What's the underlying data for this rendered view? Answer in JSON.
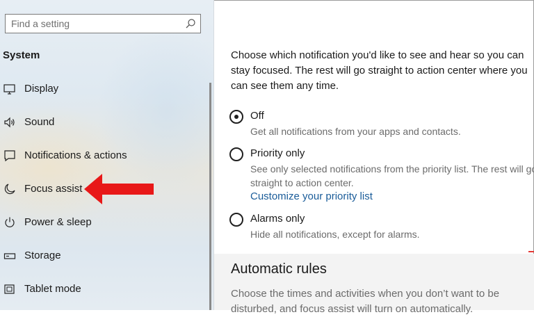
{
  "search": {
    "placeholder": "Find a setting",
    "icon": "search-icon"
  },
  "sidebar": {
    "section_title": "System",
    "items": [
      {
        "label": "Display",
        "icon": "display-icon"
      },
      {
        "label": "Sound",
        "icon": "speaker-icon"
      },
      {
        "label": "Notifications & actions",
        "icon": "notifications-icon"
      },
      {
        "label": "Focus assist",
        "icon": "moon-icon"
      },
      {
        "label": "Power & sleep",
        "icon": "power-icon"
      },
      {
        "label": "Storage",
        "icon": "storage-icon"
      },
      {
        "label": "Tablet mode",
        "icon": "tablet-icon"
      }
    ]
  },
  "annotation": {
    "arrow_color": "#e81818",
    "target": "Focus assist"
  },
  "main": {
    "intro": "Choose which notification you'd like to see and hear so you can stay focused. The rest will go straight to action center where you can see them any time.",
    "options": [
      {
        "title": "Off",
        "desc": "Get all notifications from your apps and contacts.",
        "checked": true
      },
      {
        "title": "Priority only",
        "desc": "See only selected notifications from the priority list. The rest will go straight to action center.",
        "link": "Customize your priority list",
        "checked": false
      },
      {
        "title": "Alarms only",
        "desc": "Hide all notifications, except for alarms.",
        "checked": false
      }
    ],
    "rules_title": "Automatic rules",
    "rules_desc": "Choose the times and activities when you don’t want to be disturbed, and focus assist will turn on automatically."
  },
  "colors": {
    "link": "#1a5c99",
    "accent_red": "#e81818",
    "radio": "#1f1f1f"
  }
}
